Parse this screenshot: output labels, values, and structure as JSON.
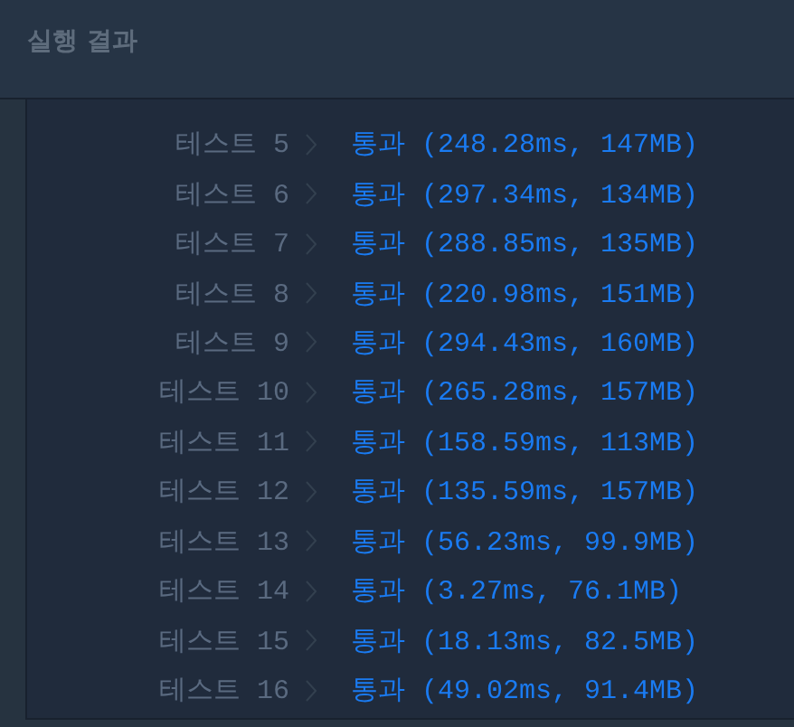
{
  "header": {
    "title": "실행 결과"
  },
  "results": [
    {
      "label": "테스트 5",
      "result": "통과 (248.28ms, 147MB)"
    },
    {
      "label": "테스트 6",
      "result": "통과 (297.34ms, 134MB)"
    },
    {
      "label": "테스트 7",
      "result": "통과 (288.85ms, 135MB)"
    },
    {
      "label": "테스트 8",
      "result": "통과 (220.98ms, 151MB)"
    },
    {
      "label": "테스트 9",
      "result": "통과 (294.43ms, 160MB)"
    },
    {
      "label": "테스트 10",
      "result": "통과 (265.28ms, 157MB)"
    },
    {
      "label": "테스트 11",
      "result": "통과 (158.59ms, 113MB)"
    },
    {
      "label": "테스트 12",
      "result": "통과 (135.59ms, 157MB)"
    },
    {
      "label": "테스트 13",
      "result": "통과 (56.23ms, 99.9MB)"
    },
    {
      "label": "테스트 14",
      "result": "통과 (3.27ms, 76.1MB)"
    },
    {
      "label": "테스트 15",
      "result": "통과 (18.13ms, 82.5MB)"
    },
    {
      "label": "테스트 16",
      "result": "통과 (49.02ms, 91.4MB)"
    }
  ]
}
